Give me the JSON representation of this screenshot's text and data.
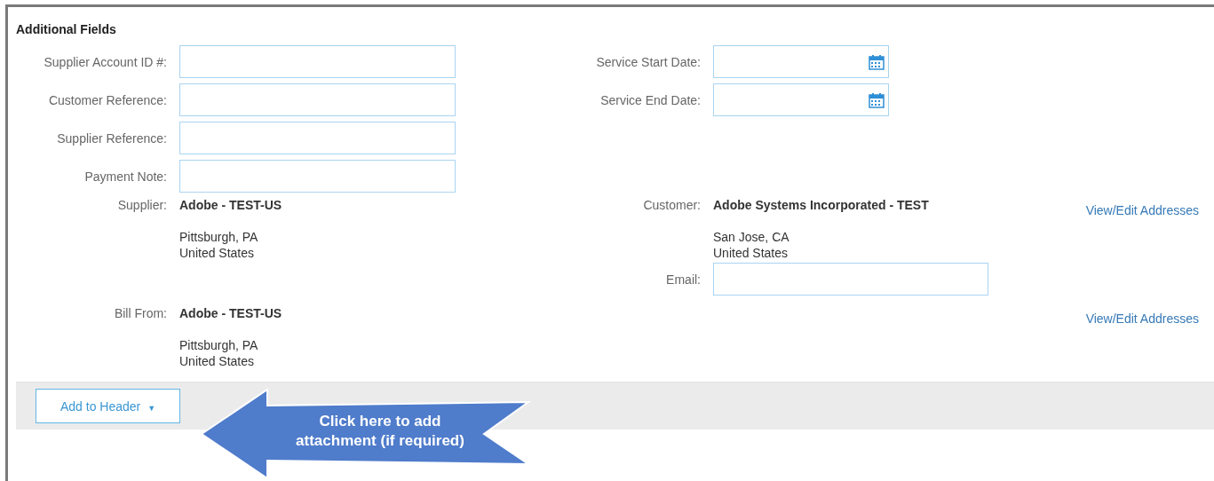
{
  "title": "Additional Fields",
  "field_rows": [
    {
      "left": {
        "label": "Supplier Account ID #:"
      },
      "right": {
        "label": "Service Start Date:",
        "kind": "date"
      }
    },
    {
      "left": {
        "label": "Customer Reference:"
      },
      "right": {
        "label": "Service End Date:",
        "kind": "date"
      }
    },
    {
      "left": {
        "label": "Supplier Reference:"
      }
    },
    {
      "left": {
        "label": "Payment Note:"
      }
    }
  ],
  "address_rows": [
    {
      "left": {
        "label": "Supplier:",
        "name": "Adobe - TEST-US",
        "city": "Pittsburgh, PA",
        "country": "United States"
      },
      "right": {
        "label": "Customer:",
        "name": "Adobe Systems Incorporated - TEST",
        "city": "San Jose, CA",
        "country": "United States"
      },
      "link": "View/Edit Addresses",
      "email": {
        "label": "Email:"
      }
    },
    {
      "left": {
        "label": "Bill From:",
        "name": "Adobe - TEST-US",
        "city": "Pittsburgh, PA",
        "country": "United States"
      },
      "link": "View/Edit Addresses"
    }
  ],
  "add_button": {
    "label": "Add to Header",
    "caret": "▼"
  },
  "callout": {
    "text": "Click here to add attachment (if required)"
  }
}
